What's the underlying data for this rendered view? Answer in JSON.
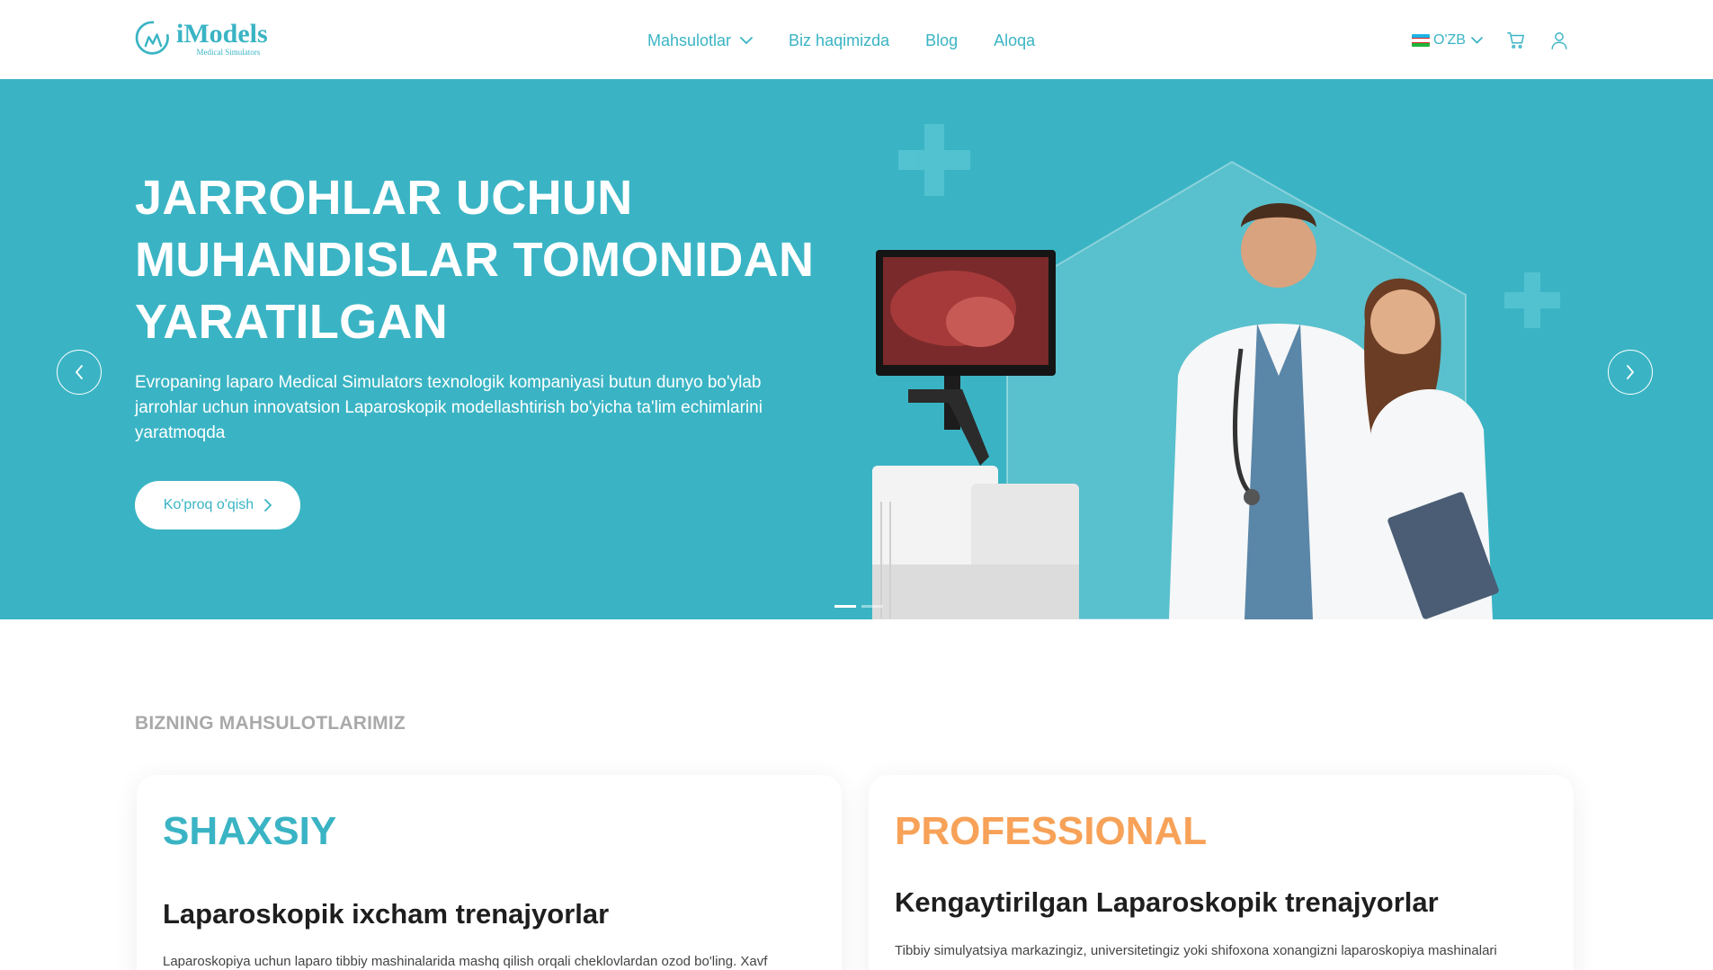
{
  "brand": {
    "name": "iModels",
    "tagline": "Medical Simulators",
    "color": "#3ab4c4"
  },
  "nav": {
    "items": [
      {
        "label": "Mahsulotlar",
        "has_dropdown": true
      },
      {
        "label": "Biz haqimizda"
      },
      {
        "label": "Blog"
      },
      {
        "label": "Aloqa"
      }
    ]
  },
  "tools": {
    "language": "O'ZB",
    "cart_icon": "cart-icon",
    "user_icon": "user-icon"
  },
  "hero": {
    "title_lines": [
      "JARROHLAR UCHUN",
      "MUHANDISLAR TOMONIDAN",
      "YARATILGAN"
    ],
    "description": "Evropaning laparo Medical Simulators texnologik kompaniyasi butun dunyo bo'ylab jarrohlar uchun innovatsion Laparoskopik modellashtirish bo'yicha ta'lim echimlarini yaratmoqda",
    "button_label": "Ko'proq o'qish",
    "slides_total": 2,
    "active_slide": 1,
    "background": "#3ab4c4"
  },
  "products": {
    "section_title": "BIZNING MAHSULOTLARIMIZ",
    "cards": [
      {
        "tag": "SHAXSIY",
        "tag_color": "#3ab4c4",
        "heading": "Laparoskopik ixcham trenajyorlar",
        "text": "Laparoskopiya uchun laparo tibbiy mashinalarida mashq qilish orqali cheklovlardan ozod bo'ling. Xavf"
      },
      {
        "tag": "PROFESSIONAL",
        "tag_color": "#f7a258",
        "heading": "Kengaytirilgan Laparoskopik trenajyorlar",
        "text": "Tibbiy simulyatsiya markazingiz, universitetingiz yoki shifoxona xonangizni laparoskopiya mashinalari"
      }
    ]
  }
}
